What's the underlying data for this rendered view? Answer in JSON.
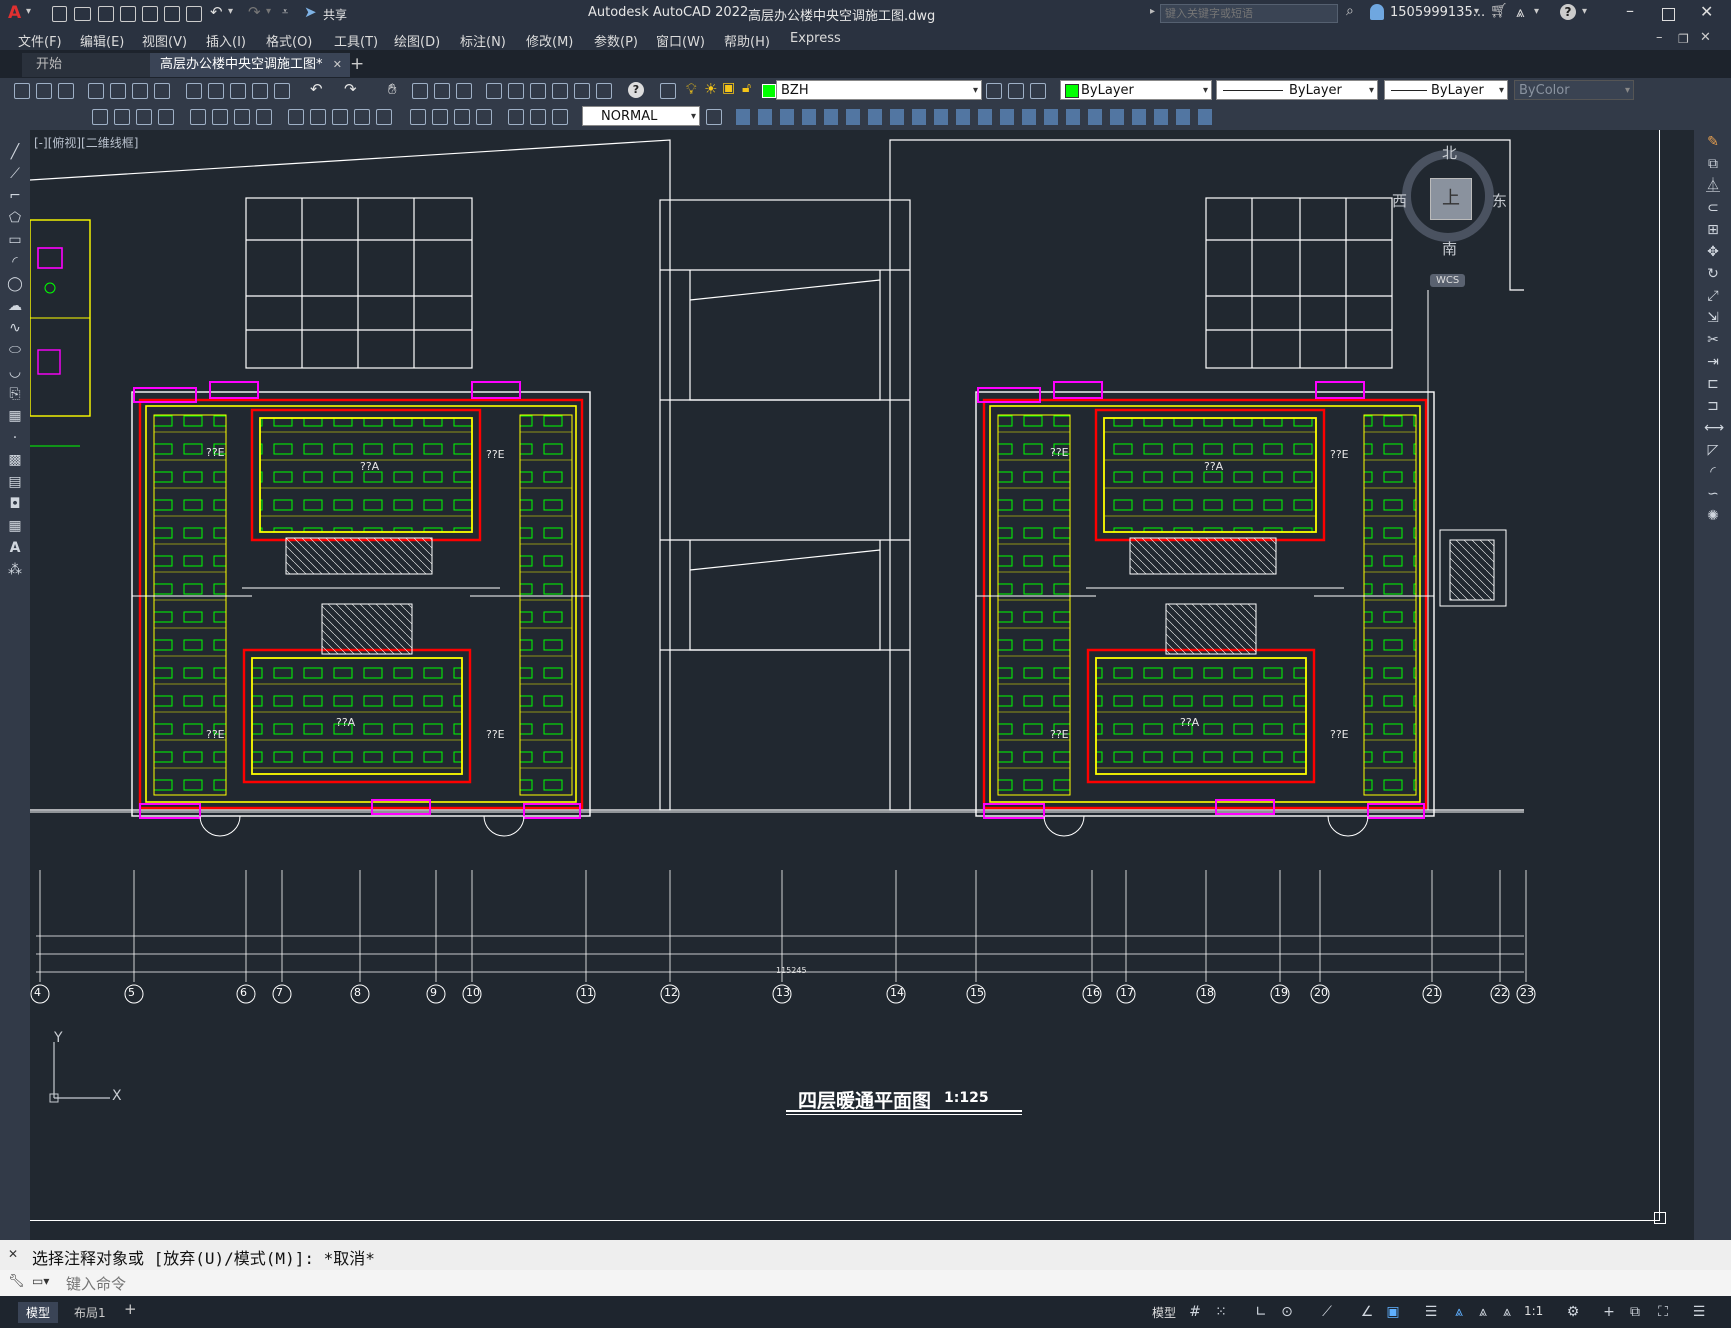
{
  "window": {
    "app_name": "Autodesk AutoCAD 2022",
    "file_name": "高层办公楼中央空调施工图.dwg",
    "search_placeholder": "键入关键字或短语",
    "user": "1505999135...",
    "share_label": "共享"
  },
  "menu": [
    "文件(F)",
    "编辑(E)",
    "视图(V)",
    "插入(I)",
    "格式(O)",
    "工具(T)",
    "绘图(D)",
    "标注(N)",
    "修改(M)",
    "参数(P)",
    "窗口(W)",
    "帮助(H)",
    "Express"
  ],
  "tabs": [
    {
      "label": "开始"
    },
    {
      "label": "高层办公楼中央空调施工图*"
    }
  ],
  "toolbar": {
    "layer": "BZH",
    "color": "ByLayer",
    "linetype": "ByLayer",
    "lineweight": "ByLayer",
    "plotstyle": "ByColor",
    "dimstyle": "NORMAL"
  },
  "viewport": {
    "label": "[-][俯视][二维线框]",
    "compass": {
      "north": "北",
      "south": "南",
      "east": "东",
      "west": "西",
      "center": "上",
      "wcs": "WCS"
    },
    "ucs": {
      "x": "X",
      "y": "Y"
    }
  },
  "drawing": {
    "title": "四层暖通平面图",
    "scale": "1:125",
    "room_labels": [
      "??E",
      "??A",
      "??E",
      "??E",
      "??A",
      "??E",
      "??E",
      "??A",
      "??E",
      "??E",
      "??A",
      "??E"
    ],
    "total_dim": "115245",
    "axes": [
      "4",
      "5",
      "6",
      "7",
      "8",
      "9",
      "10",
      "11",
      "12",
      "13",
      "14",
      "15",
      "16",
      "17",
      "18",
      "19",
      "20",
      "21",
      "22",
      "23"
    ]
  },
  "command": {
    "history": "选择注释对象或 [放弃(U)/模式(M)]: *取消*",
    "placeholder": "键入命令"
  },
  "layouts": [
    "模型",
    "布局1"
  ],
  "status": {
    "model": "模型",
    "scale": "1:1"
  }
}
